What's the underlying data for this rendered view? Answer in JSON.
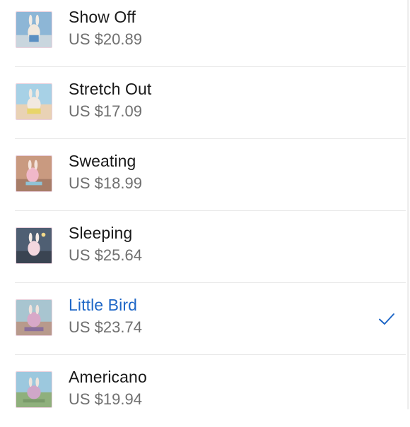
{
  "items": [
    {
      "title": "Show Off",
      "price": "US $20.89",
      "selected": false,
      "thumb": "show-off-thumbnail"
    },
    {
      "title": "Stretch Out",
      "price": "US $17.09",
      "selected": false,
      "thumb": "stretch-out-thumbnail"
    },
    {
      "title": "Sweating",
      "price": "US $18.99",
      "selected": false,
      "thumb": "sweating-thumbnail"
    },
    {
      "title": "Sleeping",
      "price": "US $25.64",
      "selected": false,
      "thumb": "sleeping-thumbnail"
    },
    {
      "title": "Little Bird",
      "price": "US $23.74",
      "selected": true,
      "thumb": "little-bird-thumbnail"
    },
    {
      "title": "Americano",
      "price": "US $19.94",
      "selected": false,
      "thumb": "americano-thumbnail"
    }
  ],
  "colors": {
    "selected_text": "#1f67c7",
    "title_text": "#191919",
    "price_text": "#707070",
    "divider": "#e8e8e8"
  },
  "icons": {
    "selected_marker": "checkmark-icon"
  }
}
